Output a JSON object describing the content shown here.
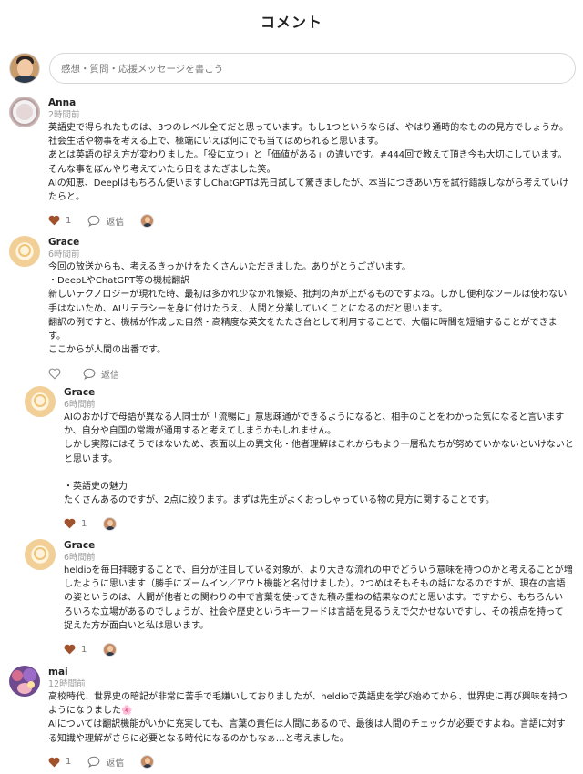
{
  "title": "コメント",
  "composer": {
    "placeholder": "感想・質問・応援メッセージを書こう"
  },
  "comments": [
    {
      "name": "Anna",
      "time": "2時間前",
      "lines": [
        "英語史で得られたものは、3つのレベル全てだと思っています。もし1つというならば、やはり通時的なものの見方でしょうか。",
        "社会生活や物事を考える上で、極端にいえば何にでも当てはめられると思います。",
        "あとは英語の捉え方が変わりました。「役に立つ」と「価値がある」の違いです。#444回で教えて頂き今も大切にしています。",
        "そんな事をぼんやり考えていたら日をまたぎました笑。",
        "AIの知恵、Deeplはもちろん使いますしChatGPTは先日試して驚きましたが、本当につきあい方を試行錯誤しながら考えていけ",
        "たらと。"
      ],
      "likes": "1",
      "reply_label": "返信"
    },
    {
      "name": "Grace",
      "time": "6時間前",
      "lines": [
        "今回の放送からも、考えるきっかけをたくさんいただきました。ありがとうございます。",
        "・DeepLやChatGPT等の機械翻訳",
        "新しいテクノロジーが現れた時、最初は多かれ少なかれ懐疑、批判の声が上がるものですよね。しかし便利なツールは使わない",
        "手はないため、AIリテラシーを身に付けたうえ、人間と分業していくことになるのだと思います。",
        "翻訳の例ですと、機械が作成した自然・高精度な英文をたたき台として利用することで、大幅に時間を短縮することができま",
        "す。",
        "ここからが人間の出番です。"
      ],
      "likes": "",
      "reply_label": "返信"
    },
    {
      "name": "Grace",
      "time": "6時間前",
      "lines": [
        "AIのおかげで母語が異なる人同士が「流暢に」意思疎通ができるようになると、相手のことをわかった気になると言います",
        "か、自分や自国の常識が通用すると考えてしまうかもしれません。",
        "しかし実際にはそうではないため、表面以上の異文化・他者理解はこれからもより一層私たちが努めていかないといけないと",
        "と思います。",
        "",
        "・英語史の魅力",
        "たくさんあるのですが、2点に絞ります。まずは先生がよくおっしゃっている物の見方に関することです。"
      ],
      "likes": "1",
      "reply_label": ""
    },
    {
      "name": "Grace",
      "time": "6時間前",
      "lines": [
        "heldioを毎日拝聴することで、自分が注目している対象が、より大きな流れの中でどういう意味を持つのかと考えることが増",
        "したように思います（勝手にズームイン／アウト機能と名付けました）。2つめはそもそもの話になるのですが、現在の言語",
        "の姿というのは、人間が他者との関わりの中で言葉を使ってきた積み重ねの結果なのだと思います。ですから、もちろんい",
        "ろいろな立場があるのでしょうが、社会や歴史というキーワードは言語を見るうえで欠かせないですし、その視点を持って",
        "捉えた方が面白いと私は思います。"
      ],
      "likes": "1",
      "reply_label": ""
    },
    {
      "name": "mai",
      "time": "12時間前",
      "lines": [
        "高校時代、世界史の暗記が非常に苦手で毛嫌いしておりましたが、heldioで英語史を学び始めてから、世界史に再び興味を持つ",
        "ようになりました🌸",
        "AIについては翻訳機能がいかに充実しても、言葉の責任は人間にあるので、最後は人間のチェックが必要ですよね。言語に対す",
        "る知識や理解がさらに必要となる時代になるのかもなぁ…と考えました。"
      ],
      "likes": "1",
      "reply_label": "返信"
    }
  ]
}
